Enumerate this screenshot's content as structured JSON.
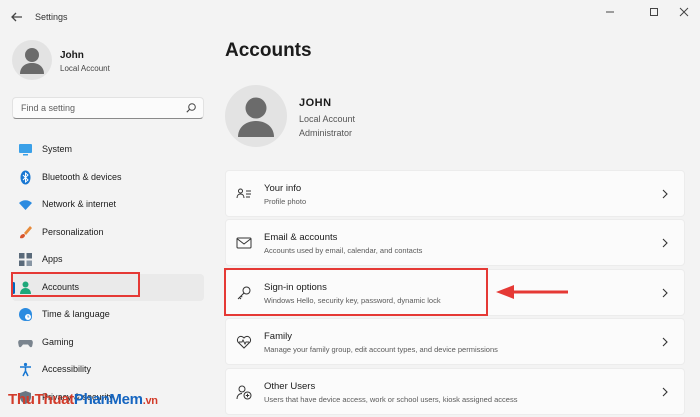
{
  "app": {
    "title": "Settings"
  },
  "user": {
    "name": "John",
    "account_type": "Local Account"
  },
  "search": {
    "placeholder": "Find a setting"
  },
  "nav": [
    {
      "label": "System",
      "icon": "monitor-icon"
    },
    {
      "label": "Bluetooth & devices",
      "icon": "bluetooth-icon"
    },
    {
      "label": "Network & internet",
      "icon": "wifi-icon"
    },
    {
      "label": "Personalization",
      "icon": "brush-icon"
    },
    {
      "label": "Apps",
      "icon": "apps-icon"
    },
    {
      "label": "Accounts",
      "icon": "person-icon",
      "selected": true
    },
    {
      "label": "Time & language",
      "icon": "clock-globe-icon"
    },
    {
      "label": "Gaming",
      "icon": "gamepad-icon"
    },
    {
      "label": "Accessibility",
      "icon": "accessibility-icon"
    },
    {
      "label": "Privacy & security",
      "icon": "shield-icon"
    }
  ],
  "page": {
    "title": "Accounts",
    "profile": {
      "name": "JOHN",
      "line1": "Local Account",
      "line2": "Administrator"
    }
  },
  "cards": [
    {
      "title": "Your info",
      "subtitle": "Profile photo",
      "icon": "contact-card-icon"
    },
    {
      "title": "Email & accounts",
      "subtitle": "Accounts used by email, calendar, and contacts",
      "icon": "mail-icon"
    },
    {
      "title": "Sign-in options",
      "subtitle": "Windows Hello, security key, password, dynamic lock",
      "icon": "key-icon"
    },
    {
      "title": "Family",
      "subtitle": "Manage your family group, edit account types, and device permissions",
      "icon": "heart-icon"
    },
    {
      "title": "Other Users",
      "subtitle": "Users that have device access, work or school users, kiosk assigned access",
      "icon": "add-person-icon"
    }
  ],
  "watermark": {
    "part1": "Thu",
    "part2": "Thuat",
    "part3": "Phan",
    "part4": "Mem",
    "part5": ".vn"
  },
  "colors": {
    "accent": "#0067c0",
    "highlight": "#e53935",
    "background": "#f3f3f3",
    "card": "#fbfbfb"
  }
}
